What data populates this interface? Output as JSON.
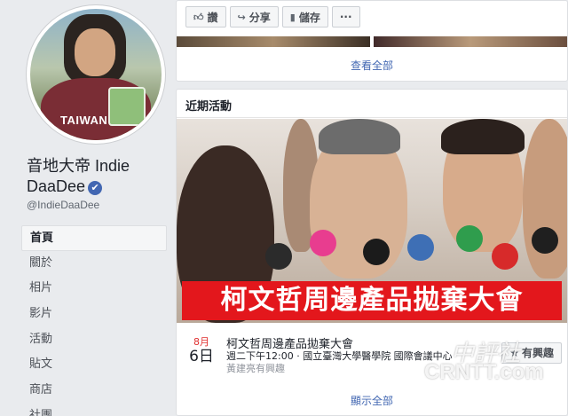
{
  "profile": {
    "name": "音地大帝 Indie DaaDee",
    "verified_mark": "✔",
    "handle": "@IndieDaaDee",
    "avatar_shirt_text": "TAIWAN"
  },
  "nav": {
    "items": [
      {
        "label": "首頁",
        "active": true
      },
      {
        "label": "關於",
        "active": false
      },
      {
        "label": "相片",
        "active": false
      },
      {
        "label": "影片",
        "active": false
      },
      {
        "label": "活動",
        "active": false
      },
      {
        "label": "貼文",
        "active": false
      },
      {
        "label": "商店",
        "active": false
      },
      {
        "label": "社團",
        "active": false
      }
    ]
  },
  "action_bar": {
    "like": "讚",
    "share": "分享",
    "save": "儲存",
    "more": "···",
    "like_icon": "thumb-up-icon",
    "share_icon": "share-arrow-icon",
    "save_icon": "bookmark-icon"
  },
  "top_card": {
    "see_all": "查看全部"
  },
  "events": {
    "title": "近期活動",
    "cover_banner": "柯文哲周邊產品拋棄大會",
    "items": [
      {
        "month": "8月",
        "day": "6日",
        "title": "柯文哲周邊產品拋棄大會",
        "when": "週二下午12:00 · 國立臺灣大學醫學院 國際會議中心",
        "sub": "黃建亮有興趣",
        "interest_label": "有興趣",
        "interest_icon": "star-icon"
      }
    ],
    "see_all": "顯示全部"
  },
  "watermark": {
    "chinese": "中評社",
    "english": "CRNTT.com"
  },
  "colors": {
    "link": "#4267b2",
    "banner_red": "#e3171c",
    "month_red": "#e02f2f",
    "background": "#e9ebee"
  }
}
